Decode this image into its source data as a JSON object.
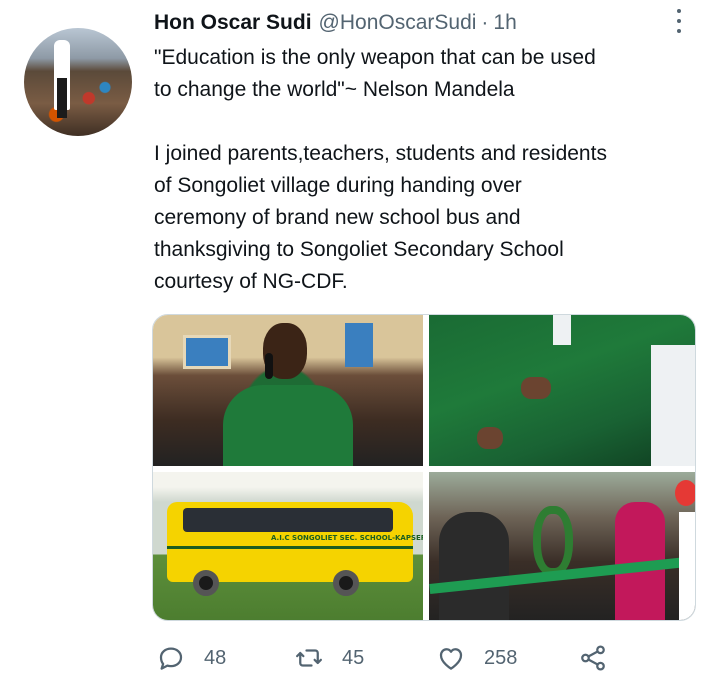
{
  "tweet": {
    "author_name": "Hon Oscar Sudi",
    "handle": "@HonOscarSudi",
    "separator": "·",
    "time": "1h",
    "text_lines": [
      "\"Education is the only weapon that can be used",
      "to change the world\"~ Nelson Mandela",
      "",
      "I joined parents,teachers, students and residents",
      "of Songoliet village during handing over",
      "ceremony of brand new school bus and",
      "thanksgiving to Songoliet Secondary School",
      "courtesy of NG-CDF."
    ],
    "bus_lettering": "A.I.C SONGOLIET SEC. SCHOOL-KAPSERET"
  },
  "actions": {
    "reply_count": "48",
    "retweet_count": "45",
    "like_count": "258"
  },
  "icons": {
    "more": "more-vertical-icon",
    "reply": "reply-icon",
    "retweet": "retweet-icon",
    "like": "heart-icon",
    "share": "share-icon"
  },
  "colors": {
    "text": "#0f1419",
    "secondary": "#536471",
    "border": "#cfd9de",
    "uniform_green": "#1f7a3a",
    "bus_yellow": "#f5d300"
  }
}
